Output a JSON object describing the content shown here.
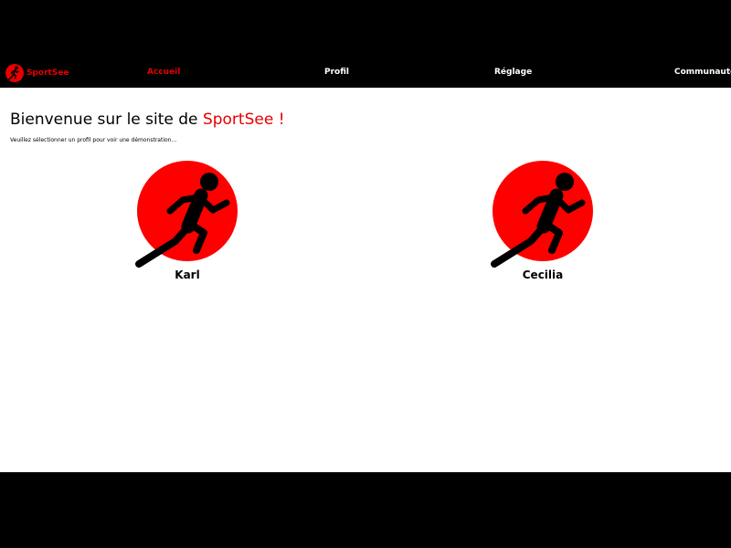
{
  "brand": {
    "name": "SportSee",
    "icon": "runner-logo-icon"
  },
  "nav": {
    "items": [
      {
        "label": "Accueil",
        "active": true
      },
      {
        "label": "Profil",
        "active": false
      },
      {
        "label": "Réglage",
        "active": false
      },
      {
        "label": "Communauté",
        "active": false
      }
    ]
  },
  "main": {
    "title_prefix": "Bienvenue sur le site de ",
    "title_accent": "SportSee !",
    "subtitle": "Veuillez sélectionner un profil pour voir une démonstration..."
  },
  "profiles": [
    {
      "name": "Karl",
      "icon": "runner-icon"
    },
    {
      "name": "Cecilia",
      "icon": "runner-icon"
    }
  ],
  "colors": {
    "accent": "#e60000",
    "background": "#ffffff",
    "bar": "#000000"
  }
}
